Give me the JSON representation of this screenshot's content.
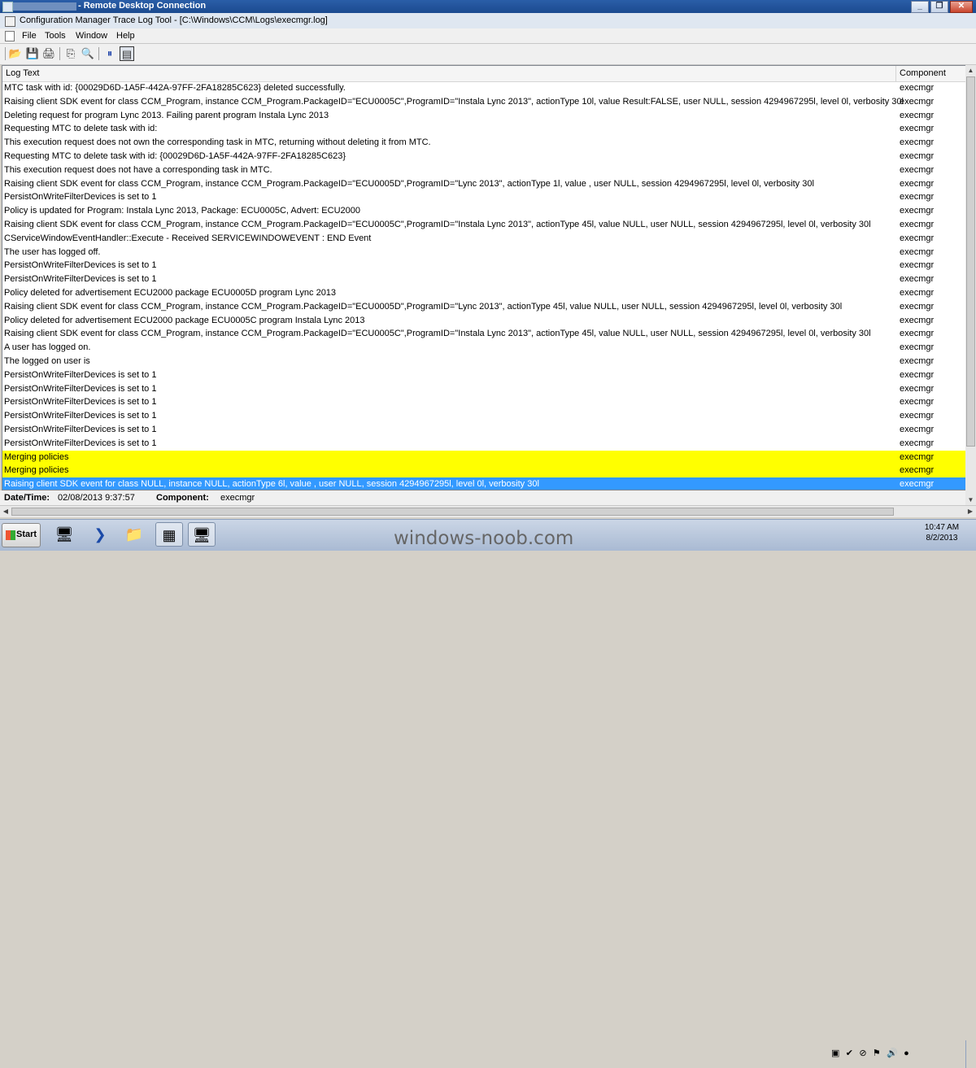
{
  "rdp": {
    "title": "- Remote Desktop Connection"
  },
  "window_buttons": {
    "minimize": "_",
    "restore": "❐",
    "close": "✕"
  },
  "app": {
    "title": "Configuration Manager Trace Log Tool - [C:\\Windows\\CCM\\Logs\\execmgr.log]"
  },
  "menu": [
    "File",
    "Tools",
    "Window",
    "Help"
  ],
  "toolbar": {
    "icons": [
      "open-icon",
      "save-icon",
      "print-icon",
      "copy-icon",
      "find-icon",
      "pause-icon",
      "highlight-icon"
    ],
    "glyphs": [
      "📂",
      "💾",
      "🖨",
      "⎘",
      "🔍",
      "⏸",
      "▤"
    ]
  },
  "grid": {
    "columns": [
      "Log Text",
      "Component"
    ],
    "rows": [
      {
        "text": "MTC task with id: {00029D6D-1A5F-442A-97FF-2FA18285C623} deleted successfully.",
        "component": "execmgr"
      },
      {
        "text": "Raising client SDK event for class CCM_Program, instance CCM_Program.PackageID=\"ECU0005C\",ProgramID=\"Instala Lync 2013\", actionType 10l, value Result:FALSE, user NULL, session 4294967295l, level 0l, verbosity 30l",
        "component": "execmgr"
      },
      {
        "text": "Deleting request for program Lync 2013. Failing parent program Instala Lync 2013",
        "component": "execmgr"
      },
      {
        "text": "Requesting MTC to delete task with id:",
        "component": "execmgr"
      },
      {
        "text": "This execution request does not own the corresponding task in MTC, returning without deleting it from MTC.",
        "component": "execmgr"
      },
      {
        "text": "Requesting MTC to delete task with id: {00029D6D-1A5F-442A-97FF-2FA18285C623}",
        "component": "execmgr"
      },
      {
        "text": "This execution request does not have a corresponding task in MTC.",
        "component": "execmgr"
      },
      {
        "text": "Raising client SDK event for class CCM_Program, instance CCM_Program.PackageID=\"ECU0005D\",ProgramID=\"Lync 2013\", actionType 1l, value , user NULL, session 4294967295l, level 0l, verbosity 30l",
        "component": "execmgr"
      },
      {
        "text": "PersistOnWriteFilterDevices is set to 1",
        "component": "execmgr"
      },
      {
        "text": "Policy is updated for Program: Instala Lync 2013, Package: ECU0005C, Advert: ECU2000",
        "component": "execmgr"
      },
      {
        "text": "Raising client SDK event for class CCM_Program, instance CCM_Program.PackageID=\"ECU0005C\",ProgramID=\"Instala Lync 2013\", actionType 45l, value NULL, user NULL, session 4294967295l, level 0l, verbosity 30l",
        "component": "execmgr"
      },
      {
        "text": "CServiceWindowEventHandler::Execute - Received SERVICEWINDOWEVENT : END Event",
        "component": "execmgr"
      },
      {
        "text": "The user has logged off.",
        "component": "execmgr"
      },
      {
        "text": "PersistOnWriteFilterDevices is set to 1",
        "component": "execmgr"
      },
      {
        "text": "PersistOnWriteFilterDevices is set to 1",
        "component": "execmgr"
      },
      {
        "text": "Policy deleted for advertisement ECU2000 package ECU0005D program Lync 2013",
        "component": "execmgr"
      },
      {
        "text": "Raising client SDK event for class CCM_Program, instance CCM_Program.PackageID=\"ECU0005D\",ProgramID=\"Lync 2013\", actionType 45l, value NULL, user NULL, session 4294967295l, level 0l, verbosity 30l",
        "component": "execmgr"
      },
      {
        "text": "Policy deleted for advertisement ECU2000 package ECU0005C program Instala Lync 2013",
        "component": "execmgr"
      },
      {
        "text": "Raising client SDK event for class CCM_Program, instance CCM_Program.PackageID=\"ECU0005C\",ProgramID=\"Instala Lync 2013\", actionType 45l, value NULL, user NULL, session 4294967295l, level 0l, verbosity 30l",
        "component": "execmgr"
      },
      {
        "text": "A user has logged on.",
        "component": "execmgr"
      },
      {
        "text": "The logged on user is",
        "component": "execmgr"
      },
      {
        "text": "PersistOnWriteFilterDevices is set to 1",
        "component": "execmgr"
      },
      {
        "text": "PersistOnWriteFilterDevices is set to 1",
        "component": "execmgr"
      },
      {
        "text": "PersistOnWriteFilterDevices is set to 1",
        "component": "execmgr"
      },
      {
        "text": "PersistOnWriteFilterDevices is set to 1",
        "component": "execmgr"
      },
      {
        "text": "PersistOnWriteFilterDevices is set to 1",
        "component": "execmgr"
      },
      {
        "text": "PersistOnWriteFilterDevices is set to 1",
        "component": "execmgr"
      },
      {
        "text": "Merging policies",
        "component": "execmgr",
        "state": "highlight"
      },
      {
        "text": "Merging policies",
        "component": "execmgr",
        "state": "highlight"
      },
      {
        "text": "Raising client SDK event for class NULL, instance NULL, actionType 6l, value , user NULL, session 4294967295l, level 0l, verbosity 30l",
        "component": "execmgr",
        "state": "selected"
      }
    ],
    "colors": {
      "highlight": "#ffff00",
      "selected": "#3399ff"
    }
  },
  "details": {
    "datetime_label": "Date/Time:",
    "datetime_value": "02/08/2013 9:37:57",
    "component_label": "Component:",
    "component_value": "execmgr"
  },
  "taskbar": {
    "start_label": "Start",
    "pinned_icons": [
      "server-manager-icon",
      "powershell-icon",
      "explorer-icon",
      "configmgr-icon",
      "remote-desktop-icon"
    ],
    "pinned_glyphs": [
      "🖥",
      "❯",
      "📁",
      "▦",
      "🖥"
    ],
    "tray_glyphs": [
      "▣",
      "✔",
      "⊘",
      "⚑",
      "🔊",
      "●"
    ],
    "time": "10:47 AM",
    "date": "8/2/2013"
  },
  "watermark": "windows-noob.com"
}
